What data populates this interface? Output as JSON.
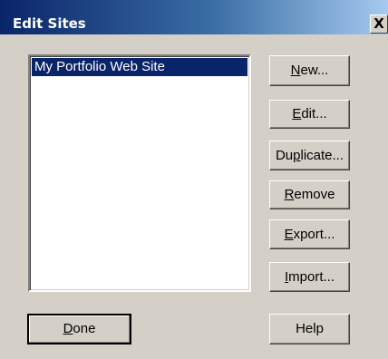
{
  "window": {
    "title": "Edit Sites",
    "close_glyph": "X"
  },
  "sites_list": {
    "items": [
      {
        "label": "My Portfolio Web Site",
        "selected": true
      }
    ]
  },
  "buttons": {
    "new": {
      "pre": "",
      "key": "N",
      "post": "ew..."
    },
    "edit": {
      "pre": "",
      "key": "E",
      "post": "dit..."
    },
    "duplicate": {
      "pre": "Du",
      "key": "p",
      "post": "licate..."
    },
    "remove": {
      "pre": "",
      "key": "R",
      "post": "emove"
    },
    "export": {
      "pre": "",
      "key": "E",
      "post": "xport..."
    },
    "import": {
      "pre": "",
      "key": "I",
      "post": "mport..."
    },
    "done": {
      "pre": "",
      "key": "D",
      "post": "one"
    },
    "help": {
      "label": "Help"
    }
  }
}
